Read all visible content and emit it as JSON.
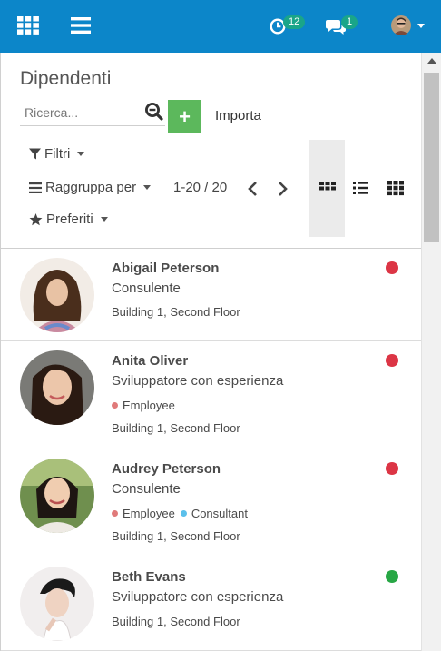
{
  "navbar": {
    "activity_count": "12",
    "message_count": "1"
  },
  "control_panel": {
    "title": "Dipendenti",
    "search_placeholder": "Ricerca...",
    "create_label": "+",
    "import_label": "Importa",
    "filters_label": "Filtri",
    "group_by_label": "Raggruppa per",
    "favorites_label": "Preferiti",
    "pager": "1-20 / 20"
  },
  "colors": {
    "navbar": "#0c86c9",
    "badge": "#1aa589",
    "create_button": "#5cb85c",
    "status_red": "#dc3545",
    "status_green": "#28a745",
    "tag_employee": "#e07a7a",
    "tag_consultant": "#5bc0eb"
  },
  "employees": [
    {
      "name": "Abigail Peterson",
      "job": "Consulente",
      "tags": [],
      "location": "Building 1, Second Floor",
      "status": "red"
    },
    {
      "name": "Anita Oliver",
      "job": "Sviluppatore con esperienza",
      "tags": [
        {
          "label": "Employee",
          "color": "#e07a7a"
        }
      ],
      "location": "Building 1, Second Floor",
      "status": "red"
    },
    {
      "name": "Audrey Peterson",
      "job": "Consulente",
      "tags": [
        {
          "label": "Employee",
          "color": "#e07a7a"
        },
        {
          "label": "Consultant",
          "color": "#5bc0eb"
        }
      ],
      "location": "Building 1, Second Floor",
      "status": "red"
    },
    {
      "name": "Beth Evans",
      "job": "Sviluppatore con esperienza",
      "tags": [],
      "location": "Building 1, Second Floor",
      "status": "green"
    }
  ]
}
